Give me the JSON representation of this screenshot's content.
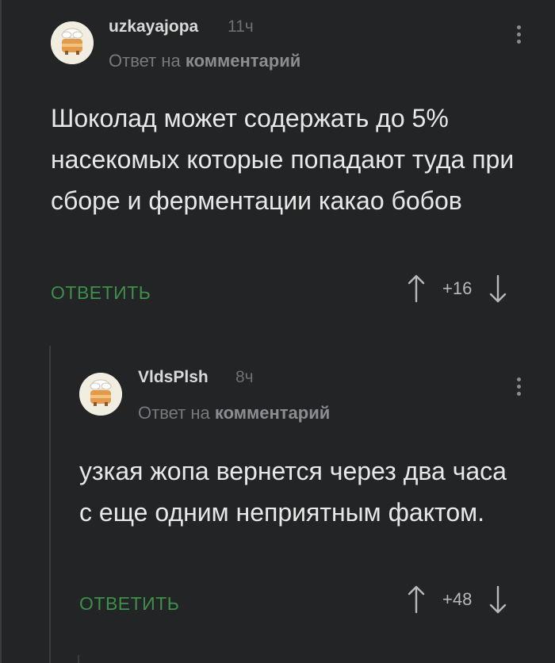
{
  "comments": [
    {
      "username": "uzkayajopa",
      "time": "11ч",
      "reply_prefix": "Ответ на",
      "reply_target": "комментарий",
      "body": "Шоколад может содержать до 5% насекомых которые попадают туда при сборе и ферментации какао бобов",
      "reply_label": "ОТВЕТИТЬ",
      "rating": "+16"
    },
    {
      "username": "VldsPlsh",
      "time": "8ч",
      "reply_prefix": "Ответ на",
      "reply_target": "комментарий",
      "body": "узкая жопа вернется через два часа с еще одним неприятным фактом.",
      "reply_label": "ОТВЕТИТЬ",
      "rating": "+48"
    }
  ],
  "icons": {
    "avatar": "cake-avatar-icon",
    "menu": "more-vertical-icon",
    "upvote": "arrow-up-icon",
    "downvote": "arrow-down-icon"
  },
  "colors": {
    "background": "#222426",
    "reply_button": "#3e8f4a",
    "muted_text": "#77797d"
  }
}
